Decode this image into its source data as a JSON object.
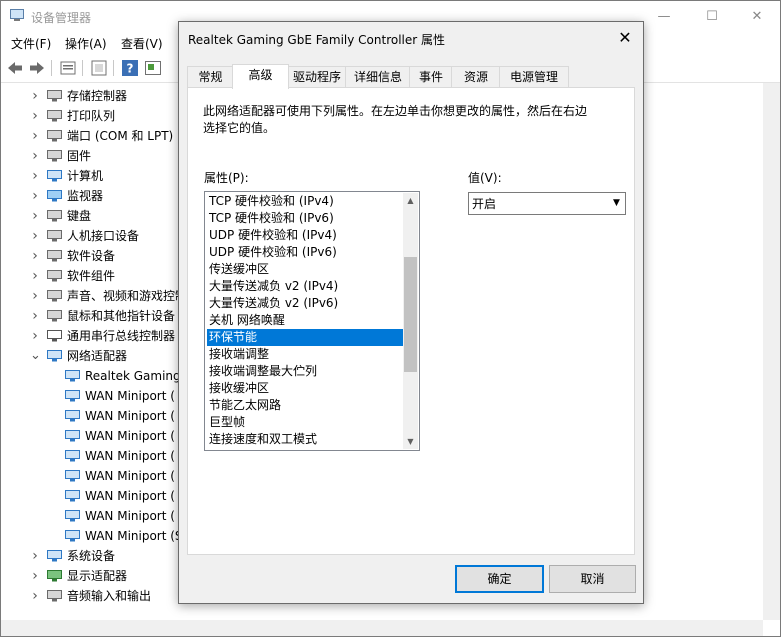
{
  "window": {
    "title": "设备管理器",
    "minimize_glyph": "—",
    "maximize_glyph": "☐",
    "close_glyph": "✕"
  },
  "menu": [
    "文件(F)",
    "操作(A)",
    "查看(V)"
  ],
  "toolbar": {
    "buttons": [
      "back-icon",
      "forward-icon",
      "properties-icon",
      "refresh-icon",
      "help-icon",
      "view-icon"
    ]
  },
  "tree": {
    "items": [
      {
        "label": "存储控制器",
        "expanded": false,
        "child": false,
        "icon": "storage-icon"
      },
      {
        "label": "打印队列",
        "expanded": false,
        "child": false,
        "icon": "printer-icon"
      },
      {
        "label": "端口 (COM 和 LPT)",
        "expanded": false,
        "child": false,
        "icon": "port-icon"
      },
      {
        "label": "固件",
        "expanded": false,
        "child": false,
        "icon": "firmware-icon"
      },
      {
        "label": "计算机",
        "expanded": false,
        "child": false,
        "icon": "computer-icon"
      },
      {
        "label": "监视器",
        "expanded": false,
        "child": false,
        "icon": "monitor-icon"
      },
      {
        "label": "键盘",
        "expanded": false,
        "child": false,
        "icon": "keyboard-icon"
      },
      {
        "label": "人机接口设备",
        "expanded": false,
        "child": false,
        "icon": "hid-icon"
      },
      {
        "label": "软件设备",
        "expanded": false,
        "child": false,
        "icon": "software-device-icon"
      },
      {
        "label": "软件组件",
        "expanded": false,
        "child": false,
        "icon": "software-component-icon"
      },
      {
        "label": "声音、视频和游戏控制器",
        "expanded": false,
        "child": false,
        "icon": "speaker-icon"
      },
      {
        "label": "鼠标和其他指针设备",
        "expanded": false,
        "child": false,
        "icon": "mouse-icon"
      },
      {
        "label": "通用串行总线控制器",
        "expanded": false,
        "child": false,
        "icon": "usb-icon"
      },
      {
        "label": "网络适配器",
        "expanded": true,
        "child": false,
        "icon": "network-adapter-icon"
      },
      {
        "label": "Realtek Gaming",
        "child": true,
        "icon": "network-adapter-icon"
      },
      {
        "label": "WAN Miniport (",
        "child": true,
        "icon": "network-adapter-icon"
      },
      {
        "label": "WAN Miniport (",
        "child": true,
        "icon": "network-adapter-icon"
      },
      {
        "label": "WAN Miniport (",
        "child": true,
        "icon": "network-adapter-icon"
      },
      {
        "label": "WAN Miniport (",
        "child": true,
        "icon": "network-adapter-icon"
      },
      {
        "label": "WAN Miniport (",
        "child": true,
        "icon": "network-adapter-icon"
      },
      {
        "label": "WAN Miniport (",
        "child": true,
        "icon": "network-adapter-icon"
      },
      {
        "label": "WAN Miniport (",
        "child": true,
        "icon": "network-adapter-icon"
      },
      {
        "label": "WAN Miniport (S",
        "child": true,
        "icon": "network-adapter-icon"
      },
      {
        "label": "系统设备",
        "expanded": false,
        "child": false,
        "icon": "system-device-icon"
      },
      {
        "label": "显示适配器",
        "expanded": false,
        "child": false,
        "icon": "display-adapter-icon"
      },
      {
        "label": "音频输入和输出",
        "expanded": false,
        "child": false,
        "icon": "audio-io-icon"
      }
    ]
  },
  "dialog": {
    "title": "Realtek Gaming GbE Family Controller 属性",
    "close_glyph": "✕",
    "tabs": [
      "常规",
      "高级",
      "驱动程序",
      "详细信息",
      "事件",
      "资源",
      "电源管理"
    ],
    "active_tab": 1,
    "description": "此网络适配器可使用下列属性。在左边单击你想更改的属性，然后在右边选择它的值。",
    "property_label": "属性(P):",
    "value_label": "值(V):",
    "properties": [
      "TCP 硬件校验和 (IPv4)",
      "TCP 硬件校验和 (IPv6)",
      "UDP 硬件校验和 (IPv4)",
      "UDP 硬件校验和 (IPv6)",
      "传送缓冲区",
      "大量传送减负 v2 (IPv4)",
      "大量传送减负 v2 (IPv6)",
      "关机 网络唤醒",
      "环保节能",
      "接收端调整",
      "接收端调整最大伫列",
      "接收缓冲区",
      "节能乙太网路",
      "巨型帧",
      "连接速度和双工模式"
    ],
    "selected_property": 8,
    "scroll_up_glyph": "▲",
    "scroll_down_glyph": "▼",
    "value": "开启",
    "combo_glyph": "▼",
    "ok_label": "确定",
    "cancel_label": "取消"
  },
  "colors": {
    "selection": "#0078d7",
    "dialog_bg": "#f0f0f0",
    "button_bg": "#e1e1e1"
  }
}
